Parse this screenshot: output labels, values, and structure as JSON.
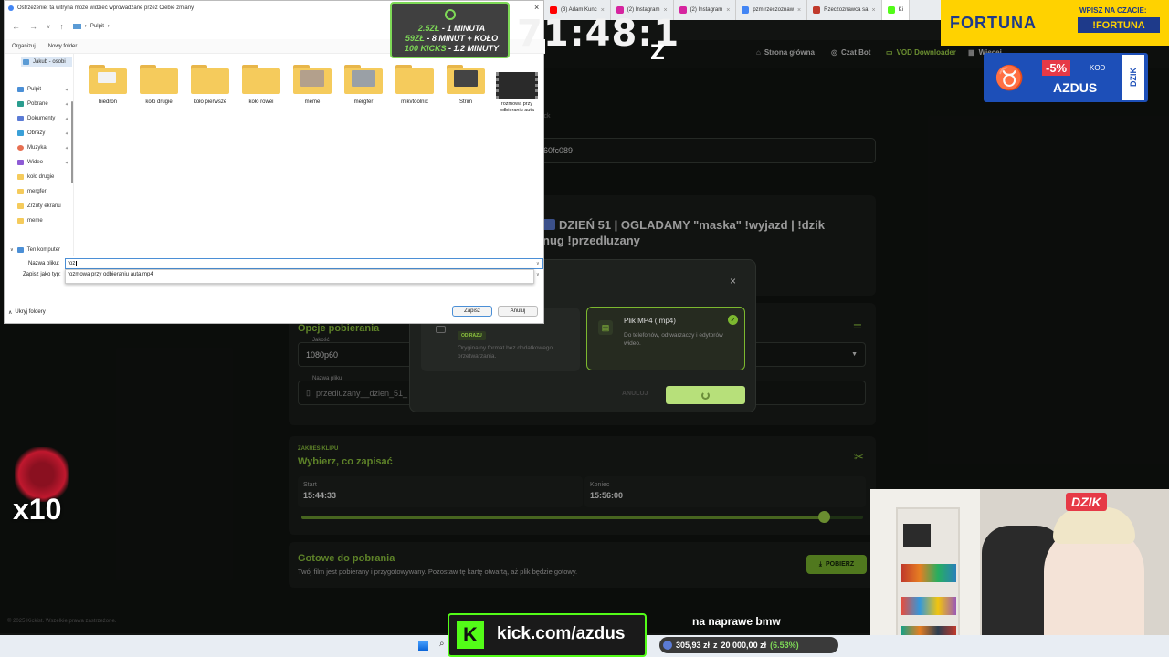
{
  "browser": {
    "tabs": [
      {
        "label": "(3) Adam Kunc",
        "color": "#ff0000"
      },
      {
        "label": "(2) Instagram",
        "color": "#d6249f"
      },
      {
        "label": "(2) Instagram",
        "color": "#d6249f"
      },
      {
        "label": "pzm rzeczoznaw",
        "color": "#4285f4"
      },
      {
        "label": "Rzeczoznawca sa",
        "color": "#c0392b"
      },
      {
        "label": "Ki",
        "color": "#53fc18"
      }
    ]
  },
  "site": {
    "nav": {
      "home": "Strona główna",
      "chat": "Czat Bot",
      "vod": "VOD Downloader",
      "more": "Więcej"
    },
    "partial_text": "ick",
    "url_fragment": "60fc089",
    "video_title": "DZIEŃ 51 | OGLADAMY \"maska\" !wyjazd | !dzik",
    "video_title2": "nug !przedluzany",
    "options_title": "Opcje pobierania",
    "quality_label": "Jakość",
    "quality_value": "1080p60",
    "filename_label": "Nazwa pliku",
    "filename_value": "przedluzany__dzien_51_",
    "range_eyebrow": "ZAKRES KLIPU",
    "range_title": "Wybierz, co zapisać",
    "start_label": "Start",
    "start_value": "15:44:33",
    "end_label": "Koniec",
    "end_value": "15:56:00",
    "range_fill": 0.93,
    "ready_title": "Gotowe do pobrania",
    "ready_desc": "Twój film jest pobierany i przygotowywany. Pozostaw tę kartę otwartą, aż plik będzie gotowy.",
    "download_label": "POBIERZ",
    "footer": "© 2025 Kickist. Wszelkie prawa zastrzeżone."
  },
  "format_modal": {
    "left_badge": "OD RAZU",
    "left_desc": "Oryginalny format bez dodatkowego przetwarzania.",
    "right_title": "Plik MP4 (.mp4)",
    "right_desc": "Do telefonów, odtwarzaczy i edytorów wideo.",
    "cancel": "ANULUJ"
  },
  "save_dialog": {
    "title": "Ostrzeżenie: ta witryna może widzieć wprowadzane przez Ciebie zmiany",
    "path": "Pulpit",
    "organize": "Organizuj",
    "new_folder": "Nowy folder",
    "nav_top": "Jakub - osobi",
    "nav": [
      "Pulpit",
      "Pobrane",
      "Dokumenty",
      "Obrazy",
      "Muzyka",
      "Wideo",
      "koło drugie",
      "mergfer",
      "Zrzuty ekranu",
      "meme"
    ],
    "nav_computer": "Ten komputer",
    "folders": [
      "biedron",
      "koło drugie",
      "koło pierwsze",
      "koło rowei",
      "meme",
      "mergfer",
      "mikvtoolnix",
      "Strim",
      "rozmowa przy odbieraniu auta"
    ],
    "filename_label": "Nazwa pliku:",
    "filename_value": "roz",
    "filetype_label": "Zapisz jako typ:",
    "suggestion": "rozmowa przy odbieraniu auta.mp4",
    "save": "Zapisz",
    "cancel": "Anuluj",
    "hide_folders": "Ukryj foldery"
  },
  "overlays": {
    "timer": "71:48:1",
    "goal": [
      {
        "a": "2.5ZŁ",
        "b": " - 1 MINUTA"
      },
      {
        "a": "59ZŁ",
        "b": " - 8 MINUT + KOŁO"
      },
      {
        "a": "100 KICKS",
        "b": " - 1.2 MINUTY"
      }
    ],
    "fortuna_brand": "FORTUNA",
    "fortuna_sub": "WPISZ NA CZACIE:",
    "fortuna_code": "!FORTUNA",
    "promo_pct": "-5%",
    "promo_kod": "KOD",
    "promo_code": "AZDUS",
    "dzik": "DZIK",
    "multiplier": "x10",
    "kick_url": "kick.com/azdus",
    "caption": "na naprawe bmw",
    "donation_current": "305,93 zł",
    "donation_sep": "z",
    "donation_goal": "20 000,00 zł",
    "donation_pct": "(6.53%)"
  }
}
